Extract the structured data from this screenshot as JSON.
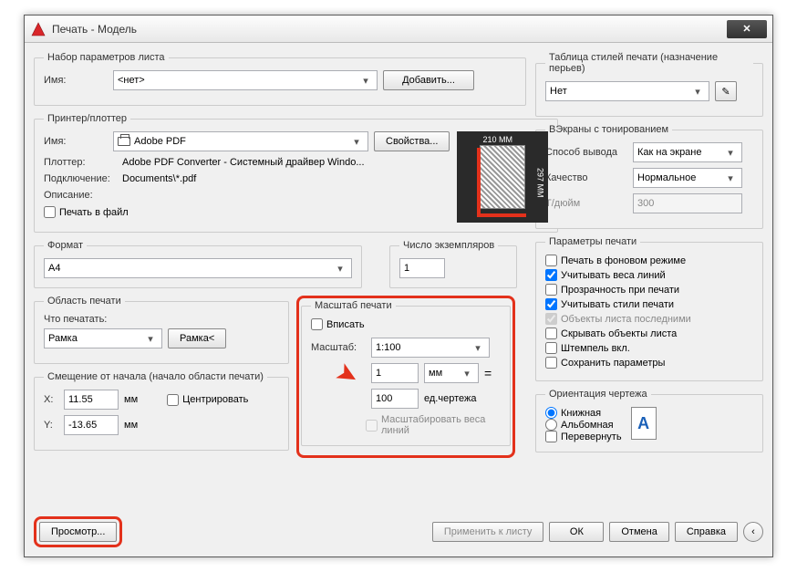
{
  "window": {
    "title": "Печать - Модель"
  },
  "pageSetup": {
    "legend": "Набор параметров листа",
    "nameLabel": "Имя:",
    "nameValue": "<нет>",
    "addButton": "Добавить..."
  },
  "printer": {
    "legend": "Принтер/плоттер",
    "nameLabel": "Имя:",
    "nameValue": "Adobe PDF",
    "propsButton": "Свойства...",
    "plotterLabel": "Плоттер:",
    "plotterValue": "Adobe PDF Converter - Системный драйвер Windo...",
    "connLabel": "Подключение:",
    "connValue": "Documents\\*.pdf",
    "descLabel": "Описание:",
    "printToFile": "Печать в файл",
    "preview": {
      "w": "210 MM",
      "h": "297 MM"
    }
  },
  "paper": {
    "formatLegend": "Формат",
    "formatValue": "A4",
    "copiesLegend": "Число экземпляров",
    "copiesValue": "1"
  },
  "plotArea": {
    "legend": "Область печати",
    "whatLabel": "Что печатать:",
    "whatValue": "Рамка",
    "windowButton": "Рамка<"
  },
  "offset": {
    "legend": "Смещение от начала (начало области печати)",
    "xLabel": "X:",
    "xValue": "11.55",
    "yLabel": "Y:",
    "yValue": "-13.65",
    "unit": "мм",
    "centerLabel": "Центрировать"
  },
  "scale": {
    "legend": "Масштаб печати",
    "fitLabel": "Вписать",
    "scaleLabel": "Масштаб:",
    "scaleValue": "1:100",
    "mmValue": "1",
    "mmUnit": "мм",
    "unitsValue": "100",
    "unitsLabel": "ед.чертежа",
    "scaleLwLabel": "Масштабировать веса линий"
  },
  "styleTable": {
    "legend": "Таблица стилей печати (назначение перьев)",
    "value": "Нет"
  },
  "shaded": {
    "legend": "ВЭкраны с тонированием",
    "modeLabel": "Способ вывода",
    "modeValue": "Как на экране",
    "qualityLabel": "Качество",
    "qualityValue": "Нормальное",
    "dpiLabel": "Т/дюйм",
    "dpiValue": "300"
  },
  "options": {
    "legend": "Параметры печати",
    "items": [
      {
        "label": "Печать в фоновом режиме",
        "checked": false,
        "enabled": true
      },
      {
        "label": "Учитывать веса линий",
        "checked": true,
        "enabled": true
      },
      {
        "label": "Прозрачность при печати",
        "checked": false,
        "enabled": true
      },
      {
        "label": "Учитывать стили печати",
        "checked": true,
        "enabled": true
      },
      {
        "label": "Объекты листа последними",
        "checked": true,
        "enabled": false
      },
      {
        "label": "Скрывать объекты листа",
        "checked": false,
        "enabled": true
      },
      {
        "label": "Штемпель вкл.",
        "checked": false,
        "enabled": true
      },
      {
        "label": "Сохранить параметры",
        "checked": false,
        "enabled": true
      }
    ]
  },
  "orientation": {
    "legend": "Ориентация чертежа",
    "portrait": "Книжная",
    "landscape": "Альбомная",
    "upside": "Перевернуть"
  },
  "footer": {
    "preview": "Просмотр...",
    "apply": "Применить к листу",
    "ok": "ОК",
    "cancel": "Отмена",
    "help": "Справка"
  }
}
